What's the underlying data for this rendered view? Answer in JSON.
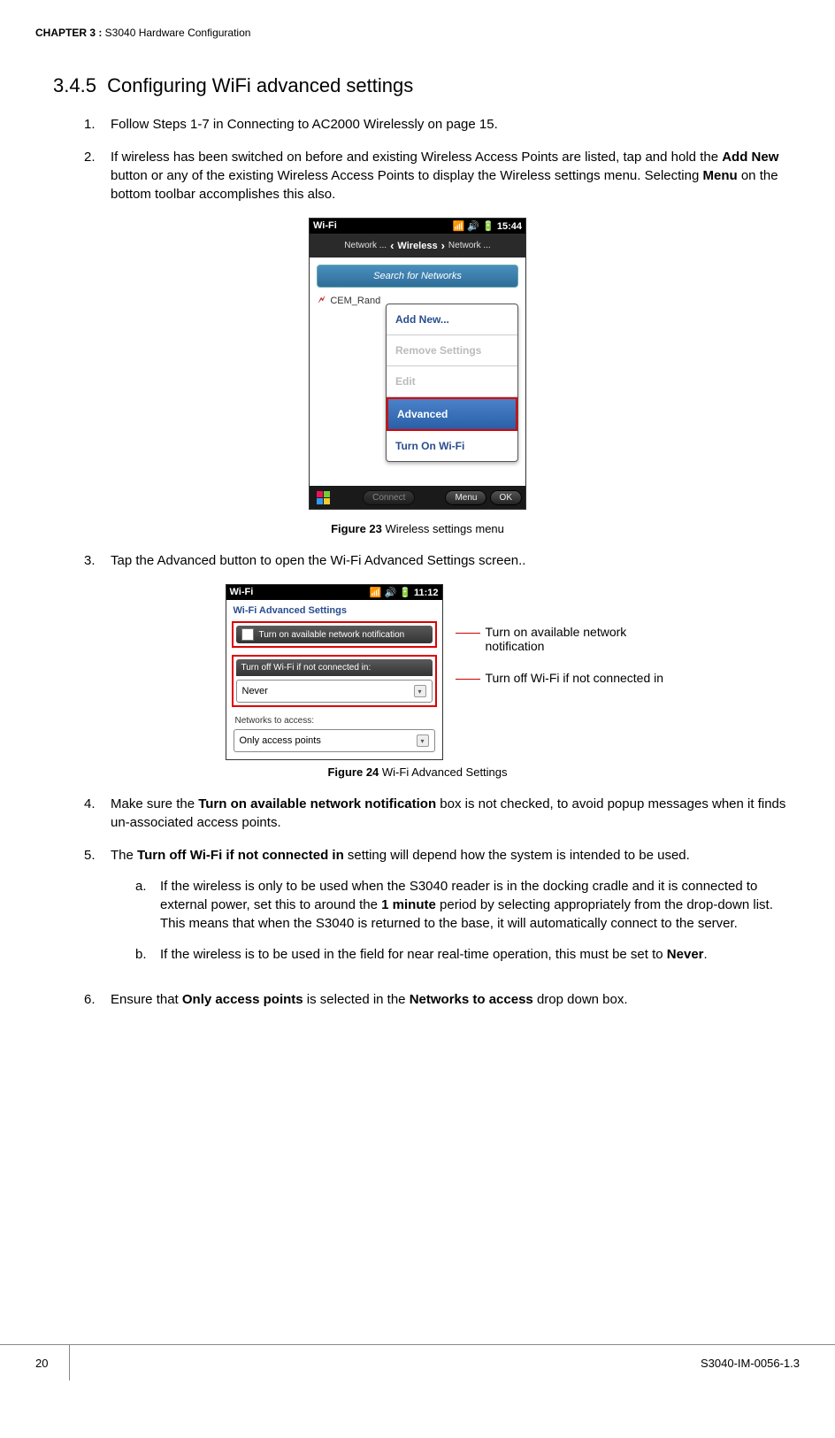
{
  "running_header": {
    "chapter_label": "CHAPTER  3 :",
    "chapter_title": " S3040 Hardware Configuration"
  },
  "section_number": "3.4.5",
  "section_title": "Configuring WiFi advanced settings",
  "steps": {
    "s1": {
      "num": "1.",
      "text": "Follow Steps 1-7 in Connecting to AC2000 Wirelessly on page 15."
    },
    "s2": {
      "num": "2.",
      "pre": "If wireless has been switched on before and existing Wireless Access Points are listed, tap and hold the ",
      "b1": "Add New",
      "mid1": " button or any of the existing Wireless Access Points to display the Wireless settings menu. Selecting ",
      "b2": "Menu",
      "post": " on the bottom toolbar accomplishes this also."
    },
    "s3": {
      "num": "3.",
      "text": "Tap the Advanced button to open the Wi-Fi Advanced Settings screen.."
    },
    "s4": {
      "num": "4.",
      "pre": "Make sure the ",
      "b1": "Turn on available network notification",
      "post": " box is not checked, to avoid popup messages when it finds un-associated access points."
    },
    "s5": {
      "num": "5.",
      "pre": "The ",
      "b1": "Turn off Wi-Fi if not connected in",
      "post": " setting will depend how the system is intended to be used."
    },
    "s5a": {
      "num": "a.",
      "pre": "If the wireless is only to be used when the S3040 reader is in the docking cradle and it is connected to external power, set this to around the ",
      "b1": "1 minute",
      "post": " period by selecting appropriately from the drop-down list. This means that when the S3040 is returned to the base, it will automatically connect to the server."
    },
    "s5b": {
      "num": "b.",
      "pre": "If the wireless is to be used in the field for near real-time operation, this must be set to ",
      "b1": "Never",
      "post": "."
    },
    "s6": {
      "num": "6.",
      "pre": "Ensure that ",
      "b1": "Only access points",
      "mid": " is selected in the ",
      "b2": "Networks to access",
      "post": " drop down box."
    }
  },
  "fig23": {
    "label": "Figure 23",
    "caption": " Wireless settings menu",
    "status_left": "Wi-Fi",
    "status_right": "15:44",
    "nav_left": "Network ...",
    "nav_center": "Wireless",
    "nav_right": "Network ...",
    "search": "Search for Networks",
    "visible_ap": "CEM_Rand",
    "menu_items": {
      "add": "Add New...",
      "remove": "Remove Settings",
      "edit": "Edit",
      "advanced": "Advanced",
      "turnon": "Turn On Wi-Fi"
    },
    "bottom_connect": "Connect",
    "bottom_menu": "Menu",
    "bottom_ok": "OK"
  },
  "fig24": {
    "label": "Figure 24",
    "caption": " Wi-Fi Advanced Settings",
    "status_left": "Wi-Fi",
    "status_right": "11:12",
    "title": "Wi-Fi Advanced Settings",
    "opt_notify": "Turn on available network notification",
    "opt_turnoff_label": "Turn off Wi-Fi if not connected in:",
    "opt_turnoff_value": "Never",
    "networks_label": "Networks to access:",
    "networks_value": "Only access points",
    "annot1": "Turn on available network notification",
    "annot2": "Turn off Wi-Fi if not connected in"
  },
  "footer": {
    "page": "20",
    "doc": "S3040-IM-0056-1.3"
  }
}
